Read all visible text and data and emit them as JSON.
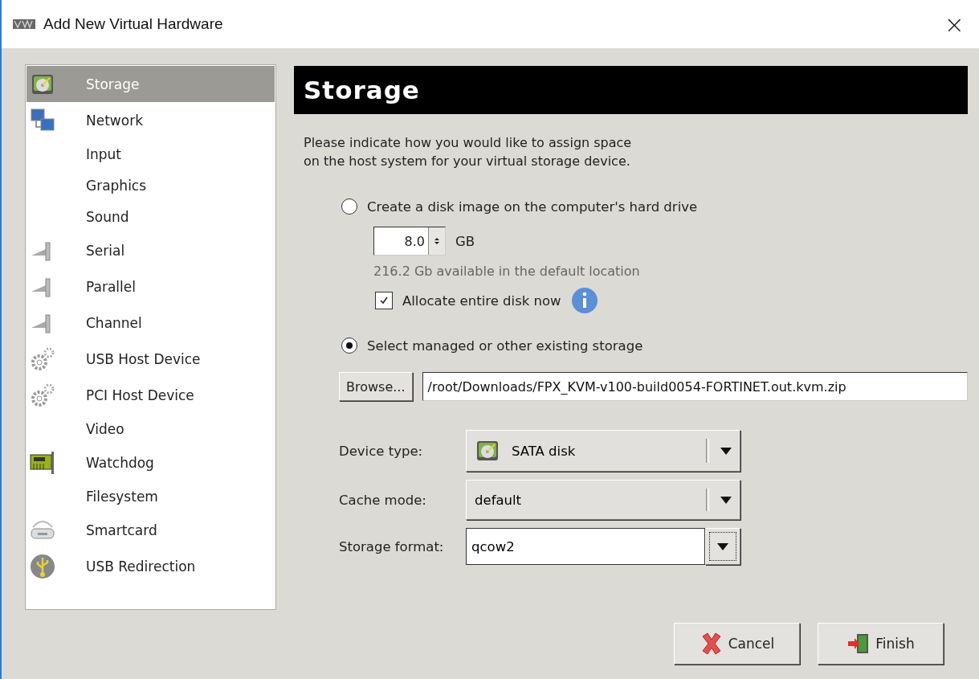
{
  "window": {
    "title": "Add New Virtual Hardware",
    "close": "×"
  },
  "sidebar": {
    "items": [
      {
        "label": "Storage",
        "kind": "disk",
        "selected": true
      },
      {
        "label": "Network",
        "kind": "network",
        "selected": false
      },
      {
        "label": "Input",
        "kind": "none",
        "selected": false
      },
      {
        "label": "Graphics",
        "kind": "none",
        "selected": false
      },
      {
        "label": "Sound",
        "kind": "none",
        "selected": false
      },
      {
        "label": "Serial",
        "kind": "plug",
        "selected": false
      },
      {
        "label": "Parallel",
        "kind": "plug",
        "selected": false
      },
      {
        "label": "Channel",
        "kind": "plug",
        "selected": false
      },
      {
        "label": "USB Host Device",
        "kind": "gears",
        "selected": false
      },
      {
        "label": "PCI Host Device",
        "kind": "gears",
        "selected": false
      },
      {
        "label": "Video",
        "kind": "none",
        "selected": false
      },
      {
        "label": "Watchdog",
        "kind": "card",
        "selected": false
      },
      {
        "label": "Filesystem",
        "kind": "none",
        "selected": false
      },
      {
        "label": "Smartcard",
        "kind": "reader",
        "selected": false
      },
      {
        "label": "USB Redirection",
        "kind": "usb",
        "selected": false
      }
    ]
  },
  "panel": {
    "heading": "Storage",
    "intro": [
      "Please indicate how you would like to assign space",
      "on the host system for your virtual storage device."
    ],
    "options": [
      {
        "label": "Create a disk image on the computer's hard drive",
        "selected": false
      },
      {
        "label": "Select managed or other existing storage",
        "selected": true
      }
    ],
    "size": {
      "value": "8.0",
      "unit": "GB",
      "hint": "216.2 Gb available in the default location"
    },
    "allocate": {
      "label": "Allocate entire disk now",
      "checked": true
    },
    "browse": {
      "button": "Browse...",
      "path": "/root/Downloads/FPX_KVM-v100-build0054-FORTINET.out.kvm.zip"
    },
    "fields": [
      {
        "label": "Device type:",
        "value": "SATA disk",
        "kind": "combo-disk"
      },
      {
        "label": "Cache mode:",
        "value": "default",
        "kind": "combo"
      },
      {
        "label": "Storage format:",
        "value": "qcow2",
        "kind": "entry-combo"
      }
    ]
  },
  "buttons": [
    {
      "label": "Cancel",
      "kind": "cancel"
    },
    {
      "label": "Finish",
      "kind": "finish"
    }
  ]
}
